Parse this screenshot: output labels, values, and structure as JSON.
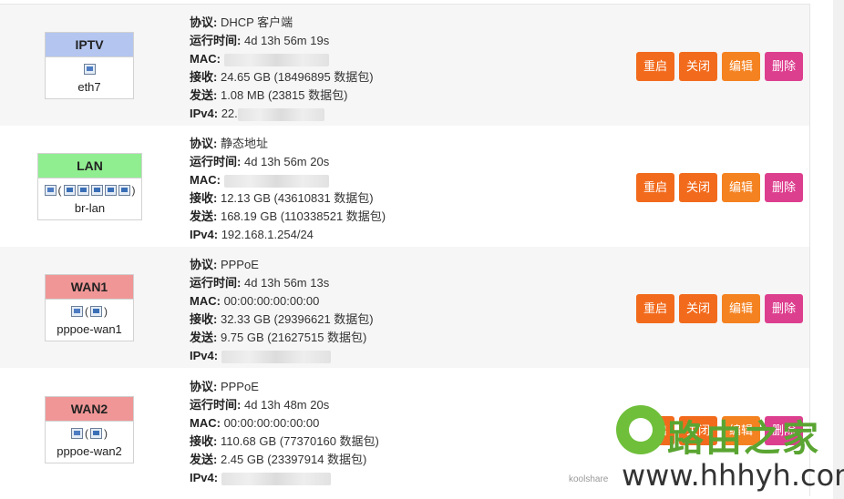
{
  "labels": {
    "protocol": "协议:",
    "uptime": "运行时间:",
    "mac": "MAC:",
    "rx": "接收:",
    "tx": "发送:",
    "ipv4": "IPv4:"
  },
  "buttons": {
    "restart": "重启",
    "stop": "关闭",
    "edit": "编辑",
    "delete": "删除"
  },
  "interfaces": [
    {
      "name": "IPTV",
      "device": "eth7",
      "header_color": "#b4c6f0",
      "protocol": "DHCP 客户端",
      "uptime": "4d 13h 56m 19s",
      "mac": "",
      "rx": "24.65 GB (18496895 数据包)",
      "tx": "1.08 MB (23815 数据包)",
      "ipv4": "22."
    },
    {
      "name": "LAN",
      "device": "br-lan",
      "header_color": "#90ee90",
      "protocol": "静态地址",
      "uptime": "4d 13h 56m 20s",
      "mac": "",
      "rx": "12.13 GB (43610831 数据包)",
      "tx": "168.19 GB (110338521 数据包)",
      "ipv4": "192.168.1.254/24"
    },
    {
      "name": "WAN1",
      "device": "pppoe-wan1",
      "header_color": "#f09696",
      "protocol": "PPPoE",
      "uptime": "4d 13h 56m 13s",
      "mac": "00:00:00:00:00:00",
      "rx": "32.33 GB (29396621 数据包)",
      "tx": "9.75 GB (21627515 数据包)",
      "ipv4": ""
    },
    {
      "name": "WAN2",
      "device": "pppoe-wan2",
      "header_color": "#f09696",
      "protocol": "PPPoE",
      "uptime": "4d 13h 48m 20s",
      "mac": "00:00:00:00:00:00",
      "rx": "110.68 GB (77370160 数据包)",
      "tx": "2.45 GB (23397914 数据包)",
      "ipv4": ""
    }
  ],
  "watermark": {
    "title": "路由之家",
    "url": "www.hhhyh.com",
    "small": "koolshare"
  }
}
